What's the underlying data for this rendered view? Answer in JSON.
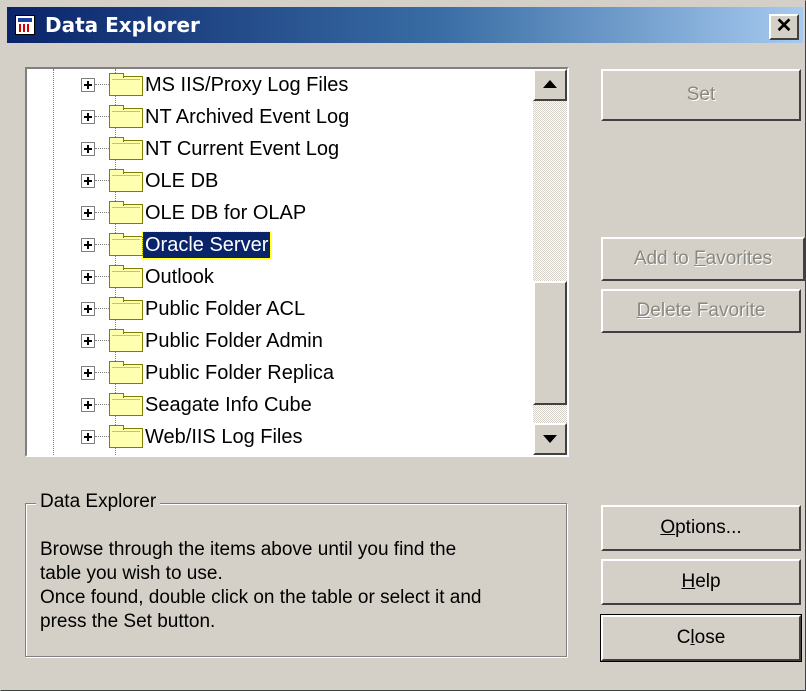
{
  "window": {
    "title": "Data Explorer",
    "close_glyph": "✕"
  },
  "tree": {
    "items": [
      {
        "label": "MS IIS/Proxy Log Files",
        "selected": false
      },
      {
        "label": "NT Archived Event Log",
        "selected": false
      },
      {
        "label": "NT Current Event Log",
        "selected": false
      },
      {
        "label": "OLE DB",
        "selected": false
      },
      {
        "label": "OLE DB for OLAP",
        "selected": false
      },
      {
        "label": "Oracle Server",
        "selected": true
      },
      {
        "label": "Outlook",
        "selected": false
      },
      {
        "label": "Public Folder ACL",
        "selected": false
      },
      {
        "label": "Public Folder Admin",
        "selected": false
      },
      {
        "label": "Public Folder Replica",
        "selected": false
      },
      {
        "label": "Seagate Info Cube",
        "selected": false
      },
      {
        "label": "Web/IIS Log Files",
        "selected": false
      }
    ],
    "expander_icon": "plus-box-icon",
    "item_icon": "folder-icon"
  },
  "buttons": {
    "set": {
      "label": "Set",
      "enabled": false
    },
    "add_to_favorites": {
      "prefix": "Add to ",
      "mnemonic": "F",
      "suffix": "avorites",
      "enabled": false
    },
    "delete_favorite": {
      "mnemonic": "D",
      "suffix": "elete Favorite",
      "enabled": false
    },
    "options": {
      "mnemonic": "O",
      "suffix": "ptions...",
      "enabled": true
    },
    "help": {
      "mnemonic": "H",
      "suffix": "elp",
      "enabled": true
    },
    "close": {
      "prefix": "C",
      "mnemonic": "l",
      "suffix": "ose",
      "enabled": true
    }
  },
  "info_group": {
    "title": "Data Explorer",
    "lines": [
      "Browse through the items above until you find the",
      "table you wish to use.",
      "Once found, double click on the table or select it and",
      "press the Set button."
    ]
  },
  "colors": {
    "titlebar_start": "#0a246a",
    "titlebar_end": "#a6caf0",
    "selection": "#0a246a",
    "face": "#d4d0c8",
    "folder": "#ffffb0"
  }
}
